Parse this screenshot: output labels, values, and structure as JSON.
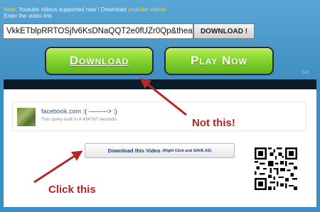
{
  "header": {
    "note_label": "Note:",
    "note_text": "Youtube videos supported now ! Download",
    "note_link": "youtube videos",
    "enter_label": "Enter the video link"
  },
  "url_input": {
    "value": "VkkETblpRRTOSjfv6KsDNaQQT2e0fUZr0Qp&theater"
  },
  "buttons": {
    "download_small": "DOWNLOAD !",
    "download_big": "Download",
    "play_now": "Play Now"
  },
  "exit_label": "Exit",
  "result": {
    "title_link": "facebook.com",
    "title_rest": ":( ---------> :)",
    "query_text": "This query built in 4.454767 seconds."
  },
  "download_video": {
    "label": "Download this Video",
    "hint": "(Right Click and SAVE AS)"
  },
  "annotations": {
    "not_this": "Not this!",
    "click_this": "Click this"
  },
  "colors": {
    "background": "#3e8fc1",
    "button_green": "#86d52e",
    "annotation_red": "#b0231e",
    "link_blue": "#1f5aa8",
    "note_yellow": "#f6d64a"
  },
  "icons": {
    "qr": "qr-code-icon",
    "thumb": "video-thumbnail"
  }
}
